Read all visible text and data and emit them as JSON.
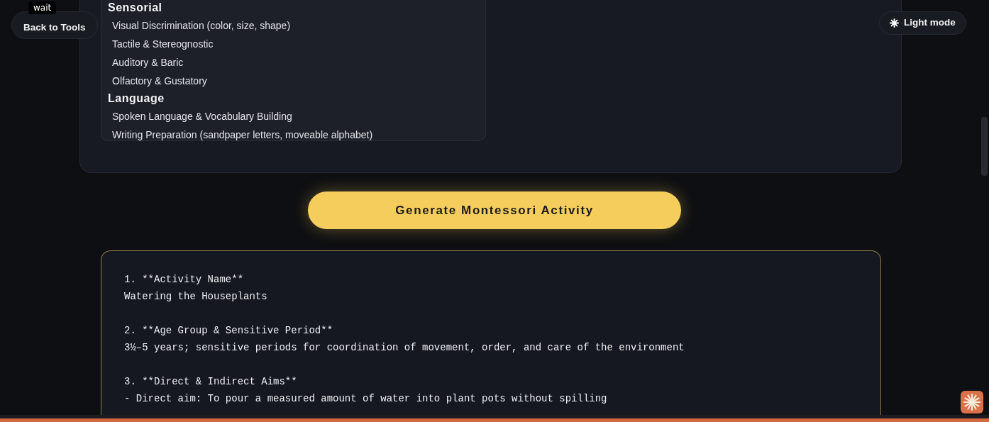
{
  "back_button": "Back to Tools",
  "tooltip": "wait",
  "theme_button": "Light mode",
  "categories": [
    {
      "name": "Sensorial",
      "items": [
        "Visual Discrimination (color, size, shape)",
        "Tactile & Stereognostic",
        "Auditory & Baric",
        "Olfactory & Gustatory"
      ]
    },
    {
      "name": "Language",
      "items": [
        "Spoken Language & Vocabulary Building",
        "Writing Preparation (sandpaper letters, moveable alphabet)"
      ]
    }
  ],
  "generate_button": "Generate Montessori Activity",
  "output_blocks": [
    {
      "lines": [
        "1. **Activity Name**",
        "Watering the Houseplants"
      ]
    },
    {
      "lines": [
        "2. **Age Group & Sensitive Period**",
        "3½–5 years; sensitive periods for coordination of movement, order, and care of the environment"
      ]
    },
    {
      "lines": [
        "3. **Direct & Indirect Aims**",
        "- Direct aim: To pour a measured amount of water into plant pots without spilling"
      ]
    }
  ]
}
